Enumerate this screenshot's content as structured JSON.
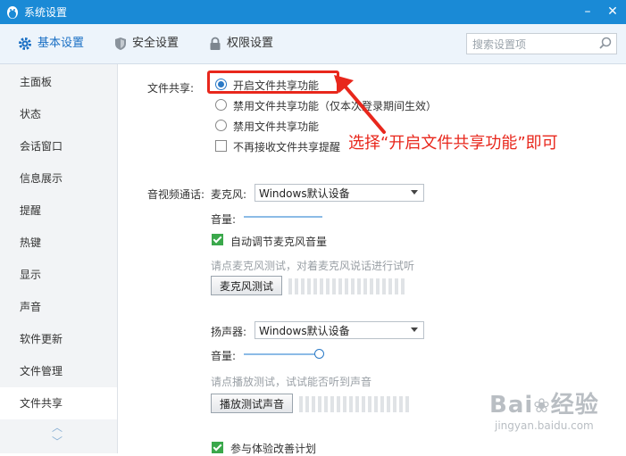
{
  "window": {
    "title": "系统设置",
    "min_label": "–",
    "close_label": "✕"
  },
  "tabs": [
    {
      "label": "基本设置",
      "icon": "gear-icon"
    },
    {
      "label": "安全设置",
      "icon": "shield-icon"
    },
    {
      "label": "权限设置",
      "icon": "lock-icon"
    }
  ],
  "search": {
    "placeholder": "搜索设置项"
  },
  "sidebar": {
    "items": [
      "主面板",
      "状态",
      "会话窗口",
      "信息展示",
      "提醒",
      "热键",
      "显示",
      "声音",
      "软件更新",
      "文件管理",
      "文件共享"
    ],
    "active_index": 10
  },
  "file_share": {
    "label": "文件共享:",
    "options": [
      "开启文件共享功能",
      "禁用文件共享功能（仅本次登录期间生效）",
      "禁用文件共享功能"
    ],
    "selected_index": 0,
    "no_remind_label": "不再接收文件共享提醒",
    "no_remind_checked": false
  },
  "av": {
    "label": "音视频通话:",
    "mic_label": "麦克风:",
    "mic_device": "Windows默认设备",
    "mic_volume_label": "音量:",
    "auto_adjust_label": "自动调节麦克风音量",
    "auto_adjust_checked": true,
    "mic_hint": "请点麦克风测试，对着麦克风说话进行试听",
    "mic_test_button": "麦克风测试",
    "speaker_label": "扬声器:",
    "speaker_device": "Windows默认设备",
    "speaker_volume_label": "音量:",
    "speaker_volume_level": 1.0,
    "speaker_hint": "请点播放测试，试试能否听到声音",
    "speaker_test_button": "播放测试声音"
  },
  "improve_plan": {
    "label": "参与体验改善计划",
    "checked": true
  },
  "annotation": {
    "text": "选择“开启文件共享功能”即可",
    "color": "#e8271c"
  },
  "watermark": {
    "brand": "Bai",
    "brand2": "经验",
    "url": "jingyan.baidu.com"
  },
  "colors": {
    "titlebar": "#1a8ad6",
    "accent": "#2a79c6",
    "check": "#3aa84b"
  }
}
